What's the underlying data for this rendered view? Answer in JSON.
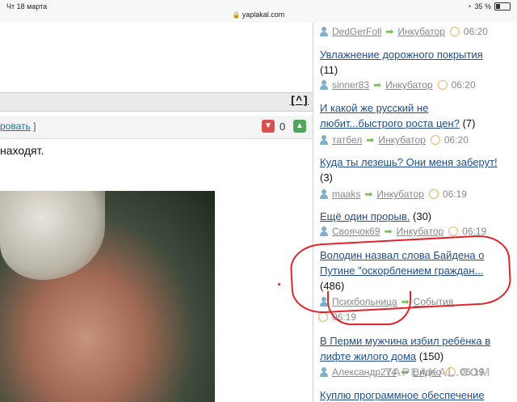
{
  "statusbar": {
    "time": "Чт 18 марта",
    "url": "yaplakal.com",
    "battery": "35 %"
  },
  "post": {
    "edit_label": "ровать",
    "edit_bracket": "]",
    "up_button": "[^]",
    "vote_count": "0",
    "text": "находят."
  },
  "sidebar": {
    "items": [
      {
        "user": "DedGerFoll",
        "section": "Инкубатор",
        "time": "06:20"
      },
      {
        "title": "Увлажнение дорожного покрытия",
        "count": "(11)",
        "user": "sinner83",
        "section": "Инкубатор",
        "time": "06:20"
      },
      {
        "title_line1": "И какой же русский не",
        "title_line2": "любит...быстрого роста цен?",
        "count": "(7)",
        "user": "татбел",
        "section": "Инкубатор",
        "time": "06:20"
      },
      {
        "title": "Куда ты лезешь? Они меня заберут!",
        "count": "(3)",
        "user": "maaks",
        "section": "Инкубатор",
        "time": "06:19"
      },
      {
        "title": "Ещё один прорыв.",
        "count": "(30)",
        "user": "Своячок69",
        "section": "Инкубатор",
        "time": "06:19"
      },
      {
        "title_line1": "Володин назвал слова Байдена о",
        "title_line2": "Путине \"оскорблением граждан...",
        "count": "(486)",
        "user": "Психбольница",
        "section": "События",
        "time": "06:19"
      },
      {
        "title_line1": "В Перми мужчина избил ребёнка в",
        "title_line2": "лифте жилого дома",
        "count": "(150)",
        "user": "Александр274",
        "section": "Видео",
        "time": "06:19"
      },
      {
        "title": "Куплю программное обеспечение"
      }
    ]
  },
  "watermark": "YAPLAKAL.COM",
  "colors": {
    "link": "#1f4e8c",
    "annotation": "#e2242a"
  }
}
